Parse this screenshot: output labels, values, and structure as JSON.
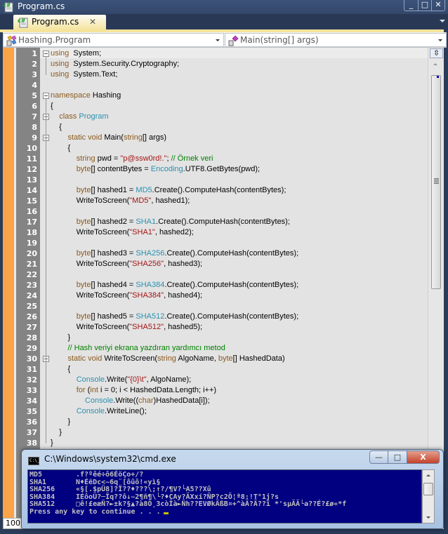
{
  "window": {
    "title": "Program.cs",
    "controls": {
      "minimize": "_",
      "maximize": "□",
      "close": "✕"
    }
  },
  "tabs": [
    {
      "label": "Program.cs",
      "icon": "csharp-file-icon",
      "close": "✕",
      "active": true
    }
  ],
  "navbar": {
    "type_combo": {
      "value": "Hashing.Program",
      "icon": "class-icon"
    },
    "member_combo": {
      "value": "Main(string[] args)",
      "icon": "method-icon"
    }
  },
  "editor": {
    "lines": [
      {
        "n": "1",
        "fold": true,
        "tokens": [
          [
            "kw",
            "using"
          ],
          [
            "",
            "  System;"
          ]
        ]
      },
      {
        "n": "2",
        "fold": false,
        "tokens": [
          [
            "kw",
            "using"
          ],
          [
            "",
            "  System.Security.Cryptography;"
          ]
        ]
      },
      {
        "n": "3",
        "fold": false,
        "tokens": [
          [
            "kw",
            "using"
          ],
          [
            "",
            "  System.Text;"
          ]
        ]
      },
      {
        "n": "4",
        "fold": false,
        "tokens": []
      },
      {
        "n": "5",
        "fold": true,
        "tokens": [
          [
            "kw",
            "namespace"
          ],
          [
            "",
            " Hashing"
          ]
        ]
      },
      {
        "n": "6",
        "fold": false,
        "tokens": [
          [
            "",
            "{"
          ]
        ]
      },
      {
        "n": "7",
        "fold": true,
        "tokens": [
          [
            "",
            "    "
          ],
          [
            "kw",
            "class"
          ],
          [
            "",
            " "
          ],
          [
            "tp",
            "Program"
          ]
        ]
      },
      {
        "n": "8",
        "fold": false,
        "tokens": [
          [
            "",
            "    {"
          ]
        ]
      },
      {
        "n": "9",
        "fold": true,
        "tokens": [
          [
            "",
            "        "
          ],
          [
            "kw",
            "static void"
          ],
          [
            "",
            " Main("
          ],
          [
            "kw",
            "string"
          ],
          [
            "",
            "[] args)"
          ]
        ]
      },
      {
        "n": "10",
        "fold": false,
        "tokens": [
          [
            "",
            "        {"
          ]
        ]
      },
      {
        "n": "11",
        "fold": false,
        "tokens": [
          [
            "",
            "            "
          ],
          [
            "kw",
            "string"
          ],
          [
            "",
            " pwd = "
          ],
          [
            "str",
            "\"p@ssw0rd!.\""
          ],
          [
            "",
            "; "
          ],
          [
            "cm",
            "// Örnek veri"
          ]
        ]
      },
      {
        "n": "12",
        "fold": false,
        "tokens": [
          [
            "",
            "            "
          ],
          [
            "kw",
            "byte"
          ],
          [
            "",
            "[] contentBytes = "
          ],
          [
            "tp",
            "Encoding"
          ],
          [
            "",
            ".UTF8.GetBytes(pwd);"
          ]
        ]
      },
      {
        "n": "13",
        "fold": false,
        "tokens": []
      },
      {
        "n": "14",
        "fold": false,
        "tokens": [
          [
            "",
            "            "
          ],
          [
            "kw",
            "byte"
          ],
          [
            "",
            "[] hashed1 = "
          ],
          [
            "tp",
            "MD5"
          ],
          [
            "",
            ".Create().ComputeHash(contentBytes);"
          ]
        ]
      },
      {
        "n": "15",
        "fold": false,
        "tokens": [
          [
            "",
            "            WriteToScreen("
          ],
          [
            "str",
            "\"MD5\""
          ],
          [
            "",
            ", hashed1);"
          ]
        ]
      },
      {
        "n": "16",
        "fold": false,
        "tokens": []
      },
      {
        "n": "17",
        "fold": false,
        "tokens": [
          [
            "",
            "            "
          ],
          [
            "kw",
            "byte"
          ],
          [
            "",
            "[] hashed2 = "
          ],
          [
            "tp",
            "SHA1"
          ],
          [
            "",
            ".Create().ComputeHash(contentBytes);"
          ]
        ]
      },
      {
        "n": "18",
        "fold": false,
        "tokens": [
          [
            "",
            "            WriteToScreen("
          ],
          [
            "str",
            "\"SHA1\""
          ],
          [
            "",
            ", hashed2);"
          ]
        ]
      },
      {
        "n": "19",
        "fold": false,
        "tokens": []
      },
      {
        "n": "20",
        "fold": false,
        "tokens": [
          [
            "",
            "            "
          ],
          [
            "kw",
            "byte"
          ],
          [
            "",
            "[] hashed3 = "
          ],
          [
            "tp",
            "SHA256"
          ],
          [
            "",
            ".Create().ComputeHash(contentBytes);"
          ]
        ]
      },
      {
        "n": "21",
        "fold": false,
        "tokens": [
          [
            "",
            "            WriteToScreen("
          ],
          [
            "str",
            "\"SHA256\""
          ],
          [
            "",
            ", hashed3);"
          ]
        ]
      },
      {
        "n": "22",
        "fold": false,
        "tokens": []
      },
      {
        "n": "23",
        "fold": false,
        "tokens": [
          [
            "",
            "            "
          ],
          [
            "kw",
            "byte"
          ],
          [
            "",
            "[] hashed4 = "
          ],
          [
            "tp",
            "SHA384"
          ],
          [
            "",
            ".Create().ComputeHash(contentBytes);"
          ]
        ]
      },
      {
        "n": "24",
        "fold": false,
        "tokens": [
          [
            "",
            "            WriteToScreen("
          ],
          [
            "str",
            "\"SHA384\""
          ],
          [
            "",
            ", hashed4);"
          ]
        ]
      },
      {
        "n": "25",
        "fold": false,
        "tokens": []
      },
      {
        "n": "26",
        "fold": false,
        "tokens": [
          [
            "",
            "            "
          ],
          [
            "kw",
            "byte"
          ],
          [
            "",
            "[] hashed5 = "
          ],
          [
            "tp",
            "SHA512"
          ],
          [
            "",
            ".Create().ComputeHash(contentBytes);"
          ]
        ]
      },
      {
        "n": "27",
        "fold": false,
        "tokens": [
          [
            "",
            "            WriteToScreen("
          ],
          [
            "str",
            "\"SHA512\""
          ],
          [
            "",
            ", hashed5);"
          ]
        ]
      },
      {
        "n": "28",
        "fold": false,
        "tokens": [
          [
            "",
            "        }"
          ]
        ]
      },
      {
        "n": "29",
        "fold": false,
        "tokens": [
          [
            "",
            "        "
          ],
          [
            "cm",
            "// Hash veriyi ekrana yazdıran yardımcı metod"
          ]
        ]
      },
      {
        "n": "30",
        "fold": true,
        "tokens": [
          [
            "",
            "        "
          ],
          [
            "kw",
            "static void"
          ],
          [
            "",
            " WriteToScreen("
          ],
          [
            "kw",
            "string"
          ],
          [
            "",
            " AlgoName, "
          ],
          [
            "kw",
            "byte"
          ],
          [
            "",
            "[] HashedData)"
          ]
        ]
      },
      {
        "n": "31",
        "fold": false,
        "tokens": [
          [
            "",
            "        {"
          ]
        ]
      },
      {
        "n": "32",
        "fold": false,
        "tokens": [
          [
            "",
            "            "
          ],
          [
            "tp",
            "Console"
          ],
          [
            "",
            ".Write("
          ],
          [
            "str",
            "\"{0}\\t\""
          ],
          [
            "",
            ", AlgoName);"
          ]
        ]
      },
      {
        "n": "33",
        "fold": false,
        "tokens": [
          [
            "",
            "            "
          ],
          [
            "kw",
            "for"
          ],
          [
            "",
            " ("
          ],
          [
            "kw",
            "int"
          ],
          [
            "",
            " i = 0; i < HashedData.Length; i++)"
          ]
        ]
      },
      {
        "n": "34",
        "fold": false,
        "tokens": [
          [
            "",
            "                "
          ],
          [
            "tp",
            "Console"
          ],
          [
            "",
            ".Write(("
          ],
          [
            "kw",
            "char"
          ],
          [
            "",
            ")HashedData[i]);"
          ]
        ]
      },
      {
        "n": "35",
        "fold": false,
        "tokens": [
          [
            "",
            "            "
          ],
          [
            "tp",
            "Console"
          ],
          [
            "",
            ".WriteLine();"
          ]
        ]
      },
      {
        "n": "36",
        "fold": false,
        "tokens": [
          [
            "",
            "        }"
          ]
        ]
      },
      {
        "n": "37",
        "fold": false,
        "tokens": [
          [
            "",
            "    }"
          ]
        ]
      },
      {
        "n": "38",
        "fold": false,
        "tokens": [
          [
            "",
            "}"
          ]
        ]
      }
    ],
    "zoom_level": "100"
  },
  "console": {
    "title": "C:\\Windows\\system32\\cmd.exe",
    "icon_text": "C:\\_",
    "controls": {
      "minimize": "—",
      "maximize": "□",
      "close": "X"
    },
    "output": [
      {
        "algo": "MD5",
        "value": ".f?ºêé÷ô6ÉöÇo+/?"
      },
      {
        "algo": "SHA1",
        "value": "N♦ÉëDc<~6q¨[ôûô!«yì§"
      },
      {
        "algo": "SHA256",
        "value": "«§[.$pÜ8]?Ï??♦???\\;↑?/¶V?└A5??Xû"
      },
      {
        "algo": "SHA384",
        "value": "IÉôoÜ?─Ïq??ô↓~2¶ñ¶\\└?♦CAy?ÄXxí?ÑP?c2Ö¦ª8:!T°1j?s"
      },
      {
        "algo": "SHA512",
        "value": "□ê!£eæÑ?►±k?§▲?à8Ö¸3còÏà►Ñh??EVØkÄßB¤+^àÄ?Ä??ï *'sµÄÄ└a??É?£ø«*f"
      }
    ],
    "prompt": "Press any key to continue . . ."
  }
}
